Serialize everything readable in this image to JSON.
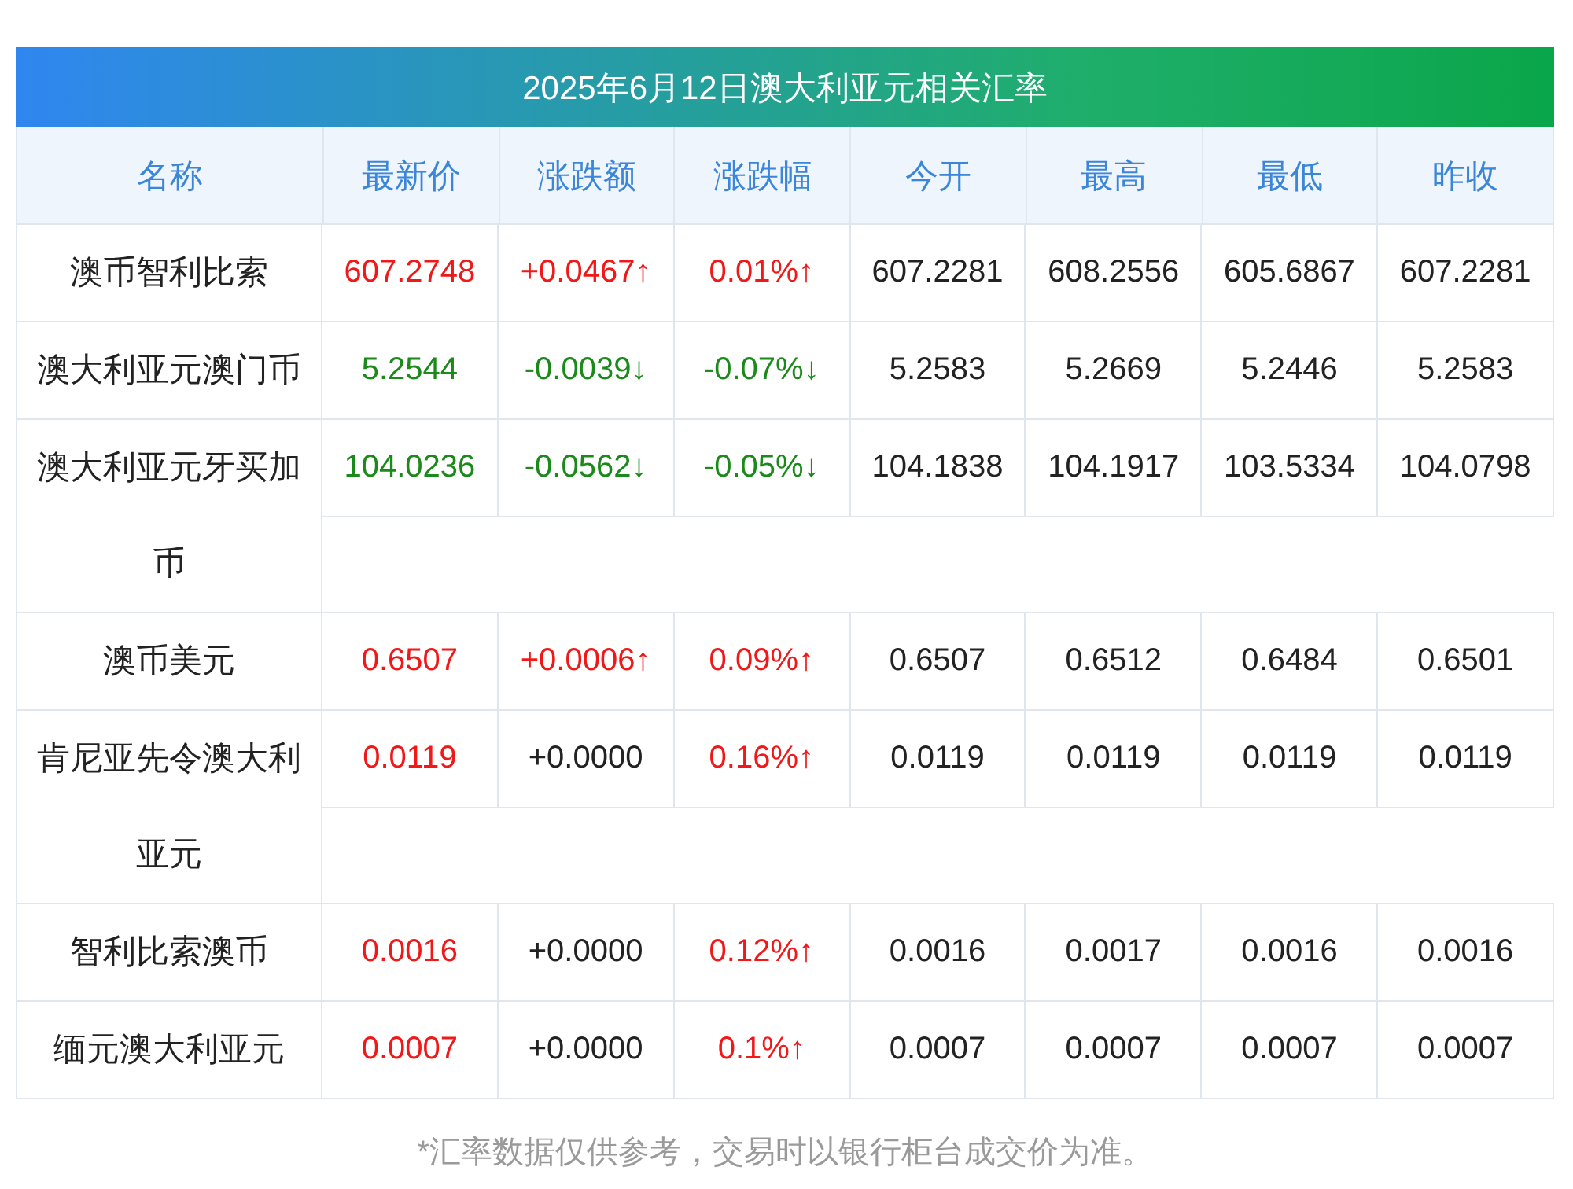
{
  "title": "2025年6月12日澳大利亚元相关汇率",
  "columns": [
    "名称",
    "最新价",
    "涨跌额",
    "涨跌幅",
    "今开",
    "最高",
    "最低",
    "昨收"
  ],
  "rows": [
    {
      "name": "澳币智利比索",
      "latest": {
        "text": "607.2748",
        "color": "#f01818"
      },
      "change": {
        "text": "+0.0467↑",
        "color": "#f01818"
      },
      "percent": {
        "text": "0.01%↑",
        "color": "#f01818"
      },
      "open": "607.2281",
      "high": "608.2556",
      "low": "605.6867",
      "prev_close": "607.2281"
    },
    {
      "name": "澳大利亚元澳门币",
      "latest": {
        "text": "5.2544",
        "color": "#1b8a1b"
      },
      "change": {
        "text": "-0.0039↓",
        "color": "#1b8a1b"
      },
      "percent": {
        "text": "-0.07%↓",
        "color": "#1b8a1b"
      },
      "open": "5.2583",
      "high": "5.2669",
      "low": "5.2446",
      "prev_close": "5.2583"
    },
    {
      "name": "澳大利亚元牙买加币",
      "latest": {
        "text": "104.0236",
        "color": "#1b8a1b"
      },
      "change": {
        "text": "-0.0562↓",
        "color": "#1b8a1b"
      },
      "percent": {
        "text": "-0.05%↓",
        "color": "#1b8a1b"
      },
      "open": "104.1838",
      "high": "104.1917",
      "low": "103.5334",
      "prev_close": "104.0798"
    },
    {
      "name": "澳币美元",
      "latest": {
        "text": "0.6507",
        "color": "#f01818"
      },
      "change": {
        "text": "+0.0006↑",
        "color": "#f01818"
      },
      "percent": {
        "text": "0.09%↑",
        "color": "#f01818"
      },
      "open": "0.6507",
      "high": "0.6512",
      "low": "0.6484",
      "prev_close": "0.6501"
    },
    {
      "name": "肯尼亚先令澳大利亚元",
      "latest": {
        "text": "0.0119",
        "color": "#f01818"
      },
      "change": {
        "text": "+0.0000",
        "color": "#222222"
      },
      "percent": {
        "text": "0.16%↑",
        "color": "#f01818"
      },
      "open": "0.0119",
      "high": "0.0119",
      "low": "0.0119",
      "prev_close": "0.0119"
    },
    {
      "name": "智利比索澳币",
      "latest": {
        "text": "0.0016",
        "color": "#f01818"
      },
      "change": {
        "text": "+0.0000",
        "color": "#222222"
      },
      "percent": {
        "text": "0.12%↑",
        "color": "#f01818"
      },
      "open": "0.0016",
      "high": "0.0017",
      "low": "0.0016",
      "prev_close": "0.0016"
    },
    {
      "name": "缅元澳大利亚元",
      "latest": {
        "text": "0.0007",
        "color": "#f01818"
      },
      "change": {
        "text": "+0.0000",
        "color": "#222222"
      },
      "percent": {
        "text": "0.1%↑",
        "color": "#f01818"
      },
      "open": "0.0007",
      "high": "0.0007",
      "low": "0.0007",
      "prev_close": "0.0007"
    }
  ],
  "footnote": "*汇率数据仅供参考，交易时以银行柜台成交价为准。"
}
